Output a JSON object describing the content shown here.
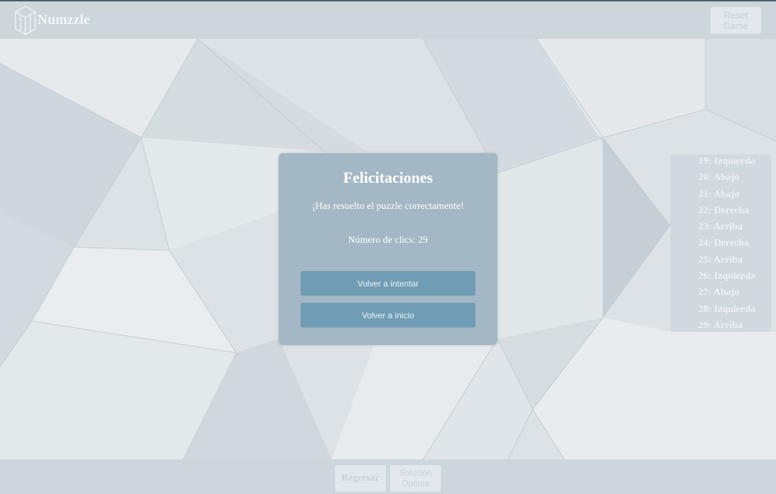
{
  "app": {
    "name": "Numzzle"
  },
  "header": {
    "reset_label": "Reset Game"
  },
  "modal": {
    "title": "Felicitaciones",
    "message": "¡Has resuelto el puzzle correctamente!",
    "clicks": "Número de clics: 29",
    "retry_label": "Volver a intentar",
    "home_label": "Volver a inicio"
  },
  "moves": [
    "19: Izquierda",
    "20: Abajo",
    "21: Abajo",
    "22: Derecha",
    "23: Arriba",
    "24: Derecha",
    "25: Arriba",
    "26: Izquierda",
    "27: Abajo",
    "28: Izquierda",
    "29: Arriba"
  ],
  "footer": {
    "back_label": "Regresar",
    "optimal_label": "Solución Optima"
  },
  "icons": {
    "logo": "hexagon-cube-logo-icon"
  },
  "colors": {
    "modal_bg": "#a3b8c4",
    "button_bg": "#709db5",
    "bar_bg": "#ccd6db"
  }
}
